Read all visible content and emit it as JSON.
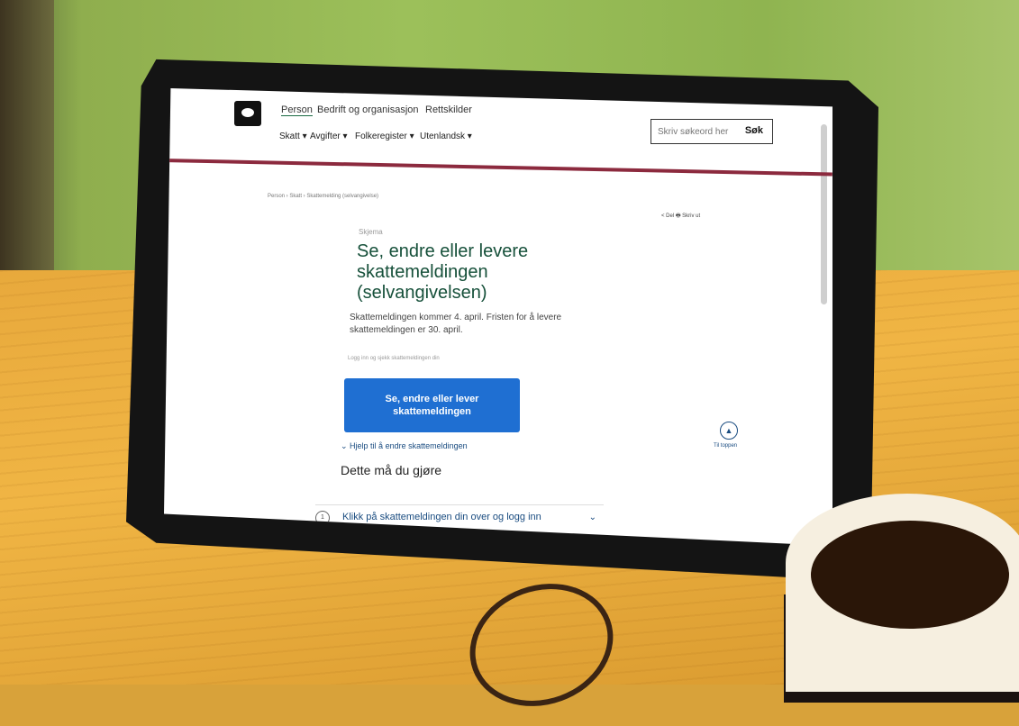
{
  "header": {
    "tabs": [
      "Person",
      "Bedrift og organisasjon",
      "Rettskilder"
    ],
    "subnav": [
      "Skatt ▾",
      "Avgifter ▾",
      "Folkeregister ▾",
      "Utenlandsk ▾"
    ],
    "search_placeholder": "Skriv søkeord her",
    "search_button": "Søk"
  },
  "breadcrumb": "Person › Skatt › Skattemelding (selvangivelse)",
  "share": "< Del   🖶 Skriv ut",
  "main": {
    "label": "Skjema",
    "title": "Se, endre eller levere skattemeldingen (selvangivelsen)",
    "lead": "Skattemeldingen kommer 4. april. Fristen for å levere skattemeldingen er 30. april.",
    "login_hint": "Logg inn og sjekk skattemeldingen din",
    "cta": "Se, endre eller lever skattemeldingen",
    "help_link": "Hjelp til å endre skattemeldingen",
    "h2": "Dette må du gjøre",
    "step_num": "1",
    "step_text": "Klikk på skattemeldingen din over og logg inn"
  },
  "to_top": "Til toppen",
  "icons": {
    "share": "share-icon",
    "print": "print-icon",
    "chevron": "chevron-down-icon",
    "arrow_up": "arrow-up-icon"
  },
  "colors": {
    "brand": "#1a6a43",
    "cta": "#1f6fd2",
    "divider": "#8c2a3e"
  }
}
